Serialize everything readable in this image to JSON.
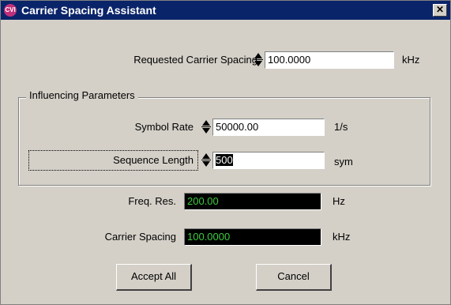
{
  "window": {
    "title": "Carrier Spacing Assistant",
    "app_icon_text": "CVI",
    "close_glyph": "✕"
  },
  "requested_spacing": {
    "label": "Requested Carrier Spacing",
    "value": "100.0000",
    "unit": "kHz"
  },
  "group": {
    "title": "Influencing Parameters",
    "symbol_rate": {
      "label": "Symbol  Rate",
      "value": "50000.00",
      "unit": "1/s"
    },
    "sequence_length": {
      "label": "Sequence Length",
      "value": "500",
      "unit": "sym"
    }
  },
  "freq_res": {
    "label": "Freq. Res.",
    "value": "200.00",
    "unit": "Hz"
  },
  "carrier_spacing": {
    "label": "Carrier Spacing",
    "value": "100.0000",
    "unit": "kHz"
  },
  "buttons": {
    "accept_all": "Accept All",
    "cancel": "Cancel"
  },
  "colors": {
    "indicator_bg": "#000000",
    "indicator_text": "#3dcc3d",
    "titlebar": "#0a246a",
    "dialog_bg": "#d4d0c8"
  }
}
